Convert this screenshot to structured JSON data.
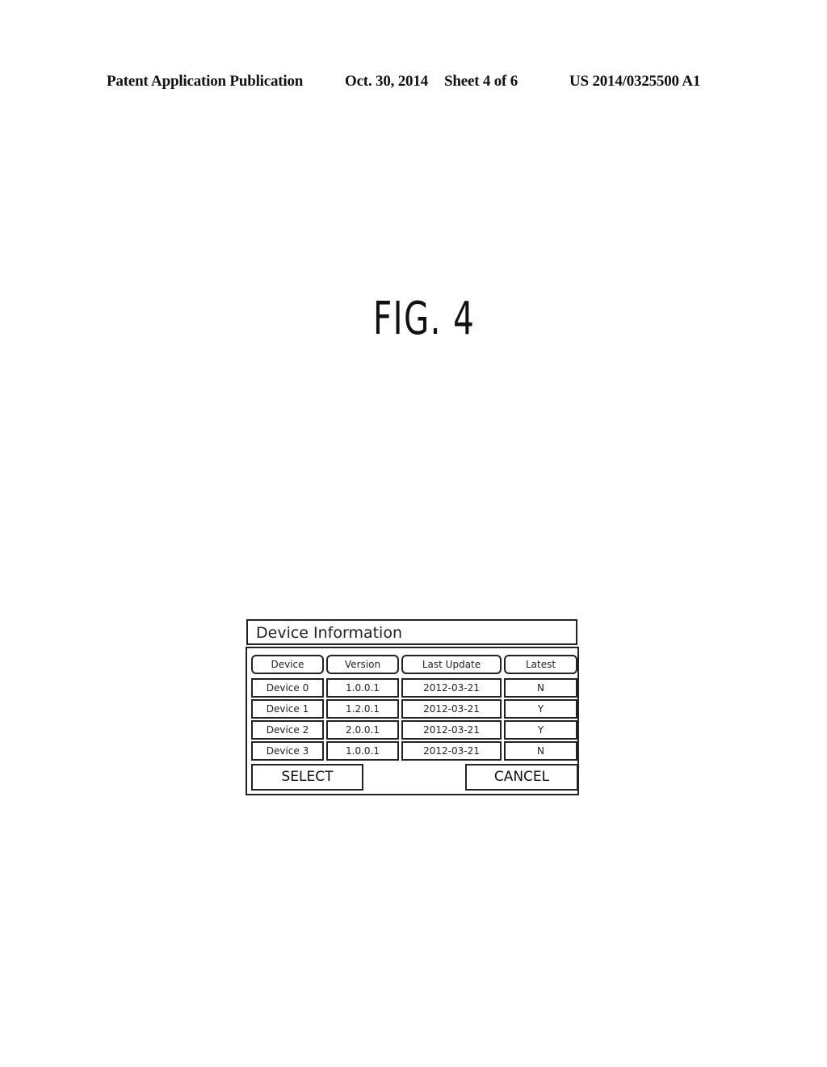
{
  "header": {
    "publication": "Patent Application Publication",
    "date": "Oct. 30, 2014",
    "sheet": "Sheet 4 of 6",
    "number": "US 2014/0325500 A1"
  },
  "figure_label": "FIG. 4",
  "dialog": {
    "title": "Device Information",
    "columns": [
      "Device",
      "Version",
      "Last Update",
      "Latest"
    ],
    "rows": [
      [
        "Device 0",
        "1.0.0.1",
        "2012-03-21",
        "N"
      ],
      [
        "Device 1",
        "1.2.0.1",
        "2012-03-21",
        "Y"
      ],
      [
        "Device 2",
        "2.0.0.1",
        "2012-03-21",
        "Y"
      ],
      [
        "Device 3",
        "1.0.0.1",
        "2012-03-21",
        "N"
      ]
    ],
    "select_label": "SELECT",
    "cancel_label": "CANCEL"
  }
}
